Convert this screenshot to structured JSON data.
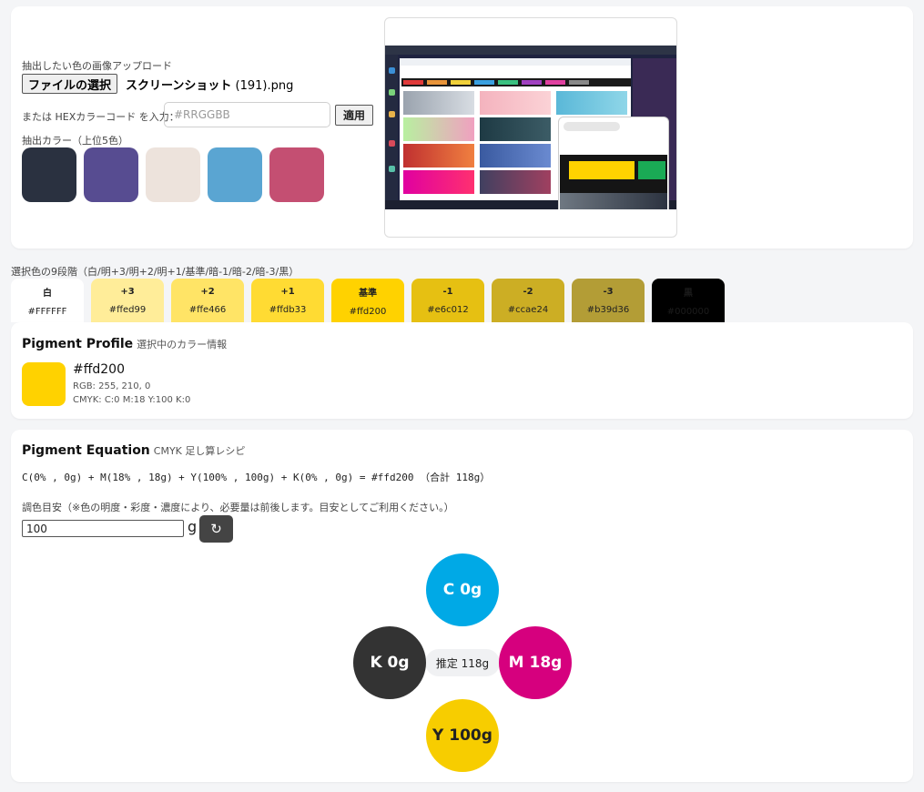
{
  "upload": {
    "label": "抽出したい色の画像アップロード",
    "file_button": "ファイルの選択",
    "file_name_bold": "スクリーンショット",
    "file_name_rest": " (191).png",
    "hex_label": "または HEXカラーコード を入力：",
    "hex_placeholder": "#RRGGBB",
    "apply_button": "適用",
    "extracted_label": "抽出カラー（上位5色）",
    "extracted_colors": [
      "#2a3140",
      "#574c91",
      "#ede3dc",
      "#5aa5d2",
      "#c44f72"
    ]
  },
  "shades": {
    "label": "選択色の9段階（白/明+3/明+2/明+1/基準/暗-1/暗-2/暗-3/黒）",
    "items": [
      {
        "name": "白",
        "hex": "#FFFFFF",
        "bg": "#ffffff",
        "fg": "#222222"
      },
      {
        "name": "+3",
        "hex": "#ffed99",
        "bg": "#ffed99",
        "fg": "#222222"
      },
      {
        "name": "+2",
        "hex": "#ffe466",
        "bg": "#ffe466",
        "fg": "#222222"
      },
      {
        "name": "+1",
        "hex": "#ffdb33",
        "bg": "#ffdb33",
        "fg": "#222222"
      },
      {
        "name": "基準",
        "hex": "#ffd200",
        "bg": "#ffd200",
        "fg": "#222222"
      },
      {
        "name": "-1",
        "hex": "#e6c012",
        "bg": "#e6c012",
        "fg": "#222222"
      },
      {
        "name": "-2",
        "hex": "#ccae24",
        "bg": "#ccae24",
        "fg": "#222222"
      },
      {
        "name": "-3",
        "hex": "#b39d36",
        "bg": "#b39d36",
        "fg": "#222222"
      },
      {
        "name": "黒",
        "hex": "#000000",
        "bg": "#000000",
        "fg": "#1c1c1c"
      }
    ]
  },
  "profile": {
    "title": "Pigment Profile",
    "subtitle": "選択中のカラー情報",
    "swatch_color": "#ffd200",
    "hex": "#ffd200",
    "rgb": "RGB: 255, 210, 0",
    "cmyk": "CMYK: C:0 M:18 Y:100 K:0"
  },
  "equation": {
    "title": "Pigment Equation",
    "subtitle": "CMYK 足し算レシピ",
    "formula": "C(0% , 0g) + M(18% , 18g) + Y(100% , 100g) + K(0% , 0g) = #ffd200 （合計 118g）",
    "note": "調色目安（※色の明度・彩度・濃度により、必要量は前後します。目安としてご利用ください。）",
    "amount_value": "100",
    "unit": "g",
    "reset_icon": "↻",
    "circles": {
      "c": {
        "label": "C 0g",
        "color": "#00a9e6"
      },
      "m": {
        "label": "M 18g",
        "color": "#d6007e"
      },
      "y": {
        "label": "Y 100g",
        "color": "#f7cd00"
      },
      "k": {
        "label": "K 0g",
        "color": "#333333"
      }
    },
    "estimate": "推定 118g"
  }
}
